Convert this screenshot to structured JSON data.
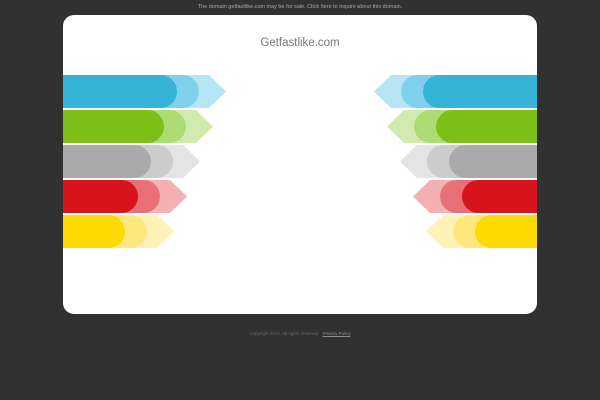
{
  "notice_text": "The domain getfastlike.com may be for sale. Click here to inquire about this domain.",
  "site_title": "Getfastlike.com",
  "footer": {
    "copyright": "Copyright 2014. All rights reserved.",
    "privacy_label": "Privacy Policy"
  },
  "stripes": [
    {
      "name": "blue",
      "dark": "#35b4d8",
      "mid": "#7fd0ea",
      "light": "#b6e5f4"
    },
    {
      "name": "green",
      "dark": "#7cbf19",
      "mid": "#addb73",
      "light": "#d1ebae"
    },
    {
      "name": "gray",
      "dark": "#aaaaaa",
      "mid": "#cccccc",
      "light": "#e4e4e4"
    },
    {
      "name": "red",
      "dark": "#d7141c",
      "mid": "#e87076",
      "light": "#f3b1b4"
    },
    {
      "name": "yellow",
      "dark": "#fed903",
      "mid": "#fee87e",
      "light": "#fff2b7"
    }
  ]
}
